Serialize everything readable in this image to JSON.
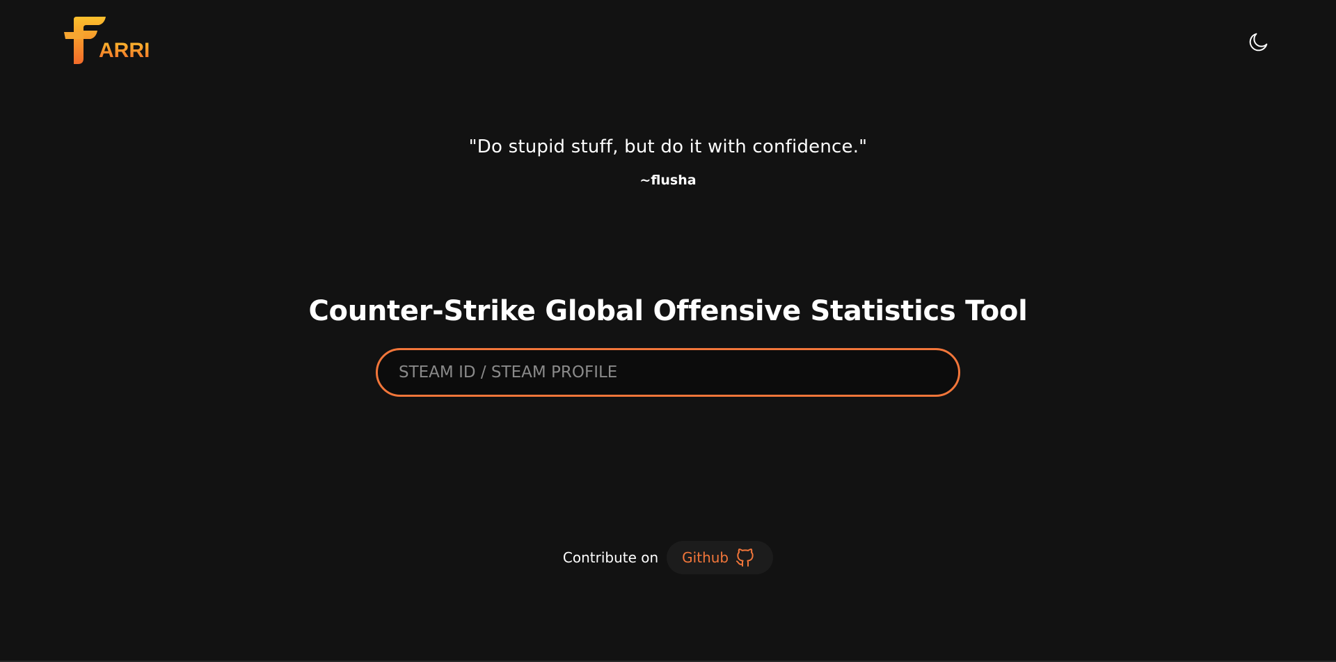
{
  "header": {
    "logo_text": "ARRI",
    "logo_letter": "F",
    "theme_toggle_icon": "moon-icon"
  },
  "quote": {
    "text": "\"Do stupid stuff, but do it with confidence.\"",
    "author": "~flusha"
  },
  "main": {
    "title": "Counter-Strike Global Offensive Statistics Tool",
    "search_placeholder": "STEAM ID / STEAM PROFILE",
    "search_value": ""
  },
  "footer": {
    "contribute_text": "Contribute on",
    "github_label": "Github",
    "github_icon": "github-icon"
  },
  "colors": {
    "background": "#121212",
    "accent": "#f2763a",
    "logo_gradient_top": "#fbc02d",
    "logo_gradient_bottom": "#f26b2a",
    "button_bg": "#1c1c1c"
  }
}
